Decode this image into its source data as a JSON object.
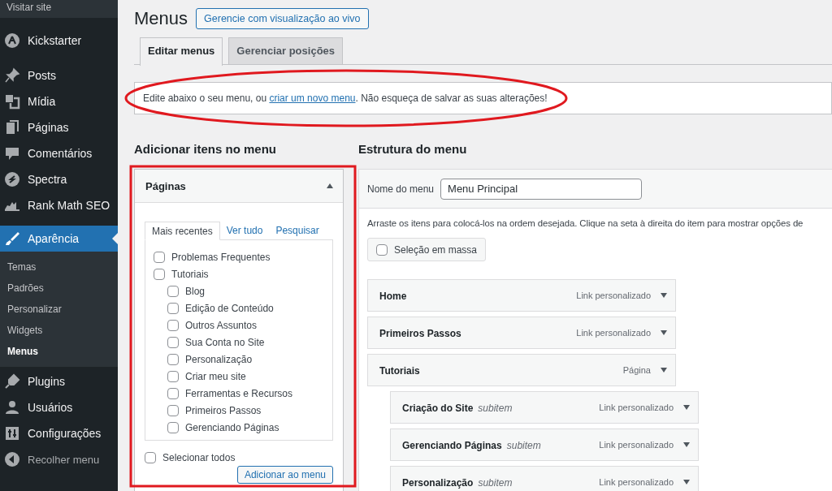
{
  "sidebar": {
    "top_link": "Visitar site",
    "items": [
      {
        "label": "Kickstarter",
        "selected": false
      },
      {
        "label": "Posts",
        "selected": false
      },
      {
        "label": "Mídia",
        "selected": false
      },
      {
        "label": "Páginas",
        "selected": false
      },
      {
        "label": "Comentários",
        "selected": false
      },
      {
        "label": "Spectra",
        "selected": false
      },
      {
        "label": "Rank Math SEO",
        "selected": false
      },
      {
        "label": "Aparência",
        "selected": true,
        "children": [
          {
            "label": "Temas",
            "selected": false
          },
          {
            "label": "Padrões",
            "selected": false
          },
          {
            "label": "Personalizar",
            "selected": false
          },
          {
            "label": "Widgets",
            "selected": false
          },
          {
            "label": "Menus",
            "selected": true
          }
        ]
      },
      {
        "label": "Plugins",
        "selected": false
      },
      {
        "label": "Usuários",
        "selected": false
      },
      {
        "label": "Configurações",
        "selected": false
      }
    ],
    "collapse": "Recolher menu"
  },
  "page": {
    "title": "Menus",
    "live_button": "Gerencie com visualização ao vivo"
  },
  "tabs": [
    {
      "label": "Editar menus",
      "selected": true
    },
    {
      "label": "Gerenciar posições",
      "selected": false
    }
  ],
  "notice": {
    "before": "Edite abaixo o seu menu, ou ",
    "link": "criar um novo menu",
    "after": ". Não esqueça de salvar as suas alterações!"
  },
  "add_items": {
    "heading": "Adicionar itens no menu",
    "panel": {
      "title": "Páginas",
      "expanded": true,
      "tabs": [
        {
          "label": "Mais recentes",
          "selected": true
        },
        {
          "label": "Ver tudo",
          "selected": false
        },
        {
          "label": "Pesquisar",
          "selected": false
        }
      ],
      "pages": [
        {
          "label": "Problemas Frequentes",
          "checked": false
        },
        {
          "label": "Tutoriais",
          "checked": false,
          "children": [
            {
              "label": "Blog",
              "checked": false
            },
            {
              "label": "Edição de Conteúdo",
              "checked": false
            },
            {
              "label": "Outros Assuntos",
              "checked": false
            },
            {
              "label": "Sua Conta no Site",
              "checked": false
            },
            {
              "label": "Personalização",
              "checked": false
            },
            {
              "label": "Criar meu site",
              "checked": false
            },
            {
              "label": "Ferramentas e Recursos",
              "checked": false
            },
            {
              "label": "Primeiros Passos",
              "checked": false
            },
            {
              "label": "Gerenciando Páginas",
              "checked": false
            }
          ]
        }
      ],
      "select_all": {
        "label": "Selecionar todos",
        "checked": false
      },
      "add_button": "Adicionar ao menu"
    }
  },
  "structure": {
    "heading": "Estrutura do menu",
    "name_label": "Nome do menu",
    "name_value": "Menu Principal",
    "instructions": "Arraste os itens para colocá-los na ordem desejada. Clique na seta à direita do item para mostrar opções de",
    "bulk": {
      "label": "Seleção em massa",
      "checked": false
    },
    "items": [
      {
        "title": "Home",
        "type": "Link personalizado"
      },
      {
        "title": "Primeiros Passos",
        "type": "Link personalizado"
      },
      {
        "title": "Tutoriais",
        "type": "Página",
        "children": [
          {
            "title": "Criação do Site",
            "note": "subitem",
            "type": "Link personalizado"
          },
          {
            "title": "Gerenciando Páginas",
            "note": "subitem",
            "type": "Link personalizado"
          },
          {
            "title": "Personalização",
            "note": "subitem",
            "type": "Link personalizado"
          }
        ]
      }
    ]
  }
}
